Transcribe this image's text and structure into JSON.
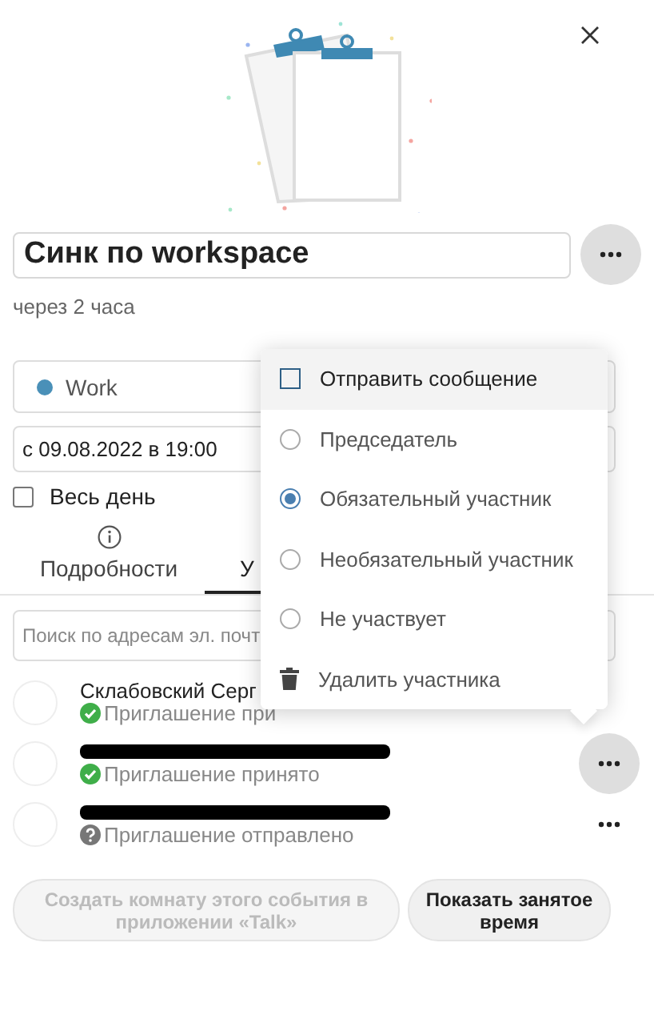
{
  "title_field": {
    "value": "Синк по workspace"
  },
  "relative_time": "через 2 часа",
  "calendar": {
    "label": "Work",
    "color": "#4a90b8"
  },
  "date_field": {
    "value": "с 09.08.2022 в 19:00"
  },
  "all_day": {
    "label": "Весь день",
    "checked": false
  },
  "tabs": [
    {
      "label": "Подробности",
      "selected": false
    },
    {
      "label": "У",
      "selected": true
    }
  ],
  "search": {
    "placeholder": "Поиск по адресам эл. почт"
  },
  "attendees": [
    {
      "name": "Склабовский Серг",
      "redacted": false,
      "status": "Приглашение при",
      "kind": "accepted"
    },
    {
      "redacted": true,
      "status": "Приглашение принято",
      "kind": "accepted",
      "menu_open": true
    },
    {
      "redacted": true,
      "status": "Приглашение отправлено",
      "kind": "pending",
      "menu_open": false
    }
  ],
  "attendee_menu": [
    {
      "kind": "checkbox",
      "label": "Отправить сообщение",
      "checked": false,
      "highlighted": true
    },
    {
      "kind": "radio",
      "label": "Председатель",
      "selected": false,
      "highlighted": false
    },
    {
      "kind": "radio",
      "label": "Обязательный участник",
      "selected": true,
      "highlighted": false
    },
    {
      "kind": "radio",
      "label": "Необязательный участник",
      "selected": false,
      "highlighted": false
    },
    {
      "kind": "radio",
      "label": "Не участвует",
      "selected": false,
      "highlighted": false
    },
    {
      "kind": "delete",
      "label": "Удалить участника",
      "highlighted": false
    }
  ],
  "buttons": [
    {
      "label": "Создать комнату этого события в приложении «Talk»",
      "disabled": true
    },
    {
      "label": "Показать занятое время",
      "disabled": false
    }
  ]
}
